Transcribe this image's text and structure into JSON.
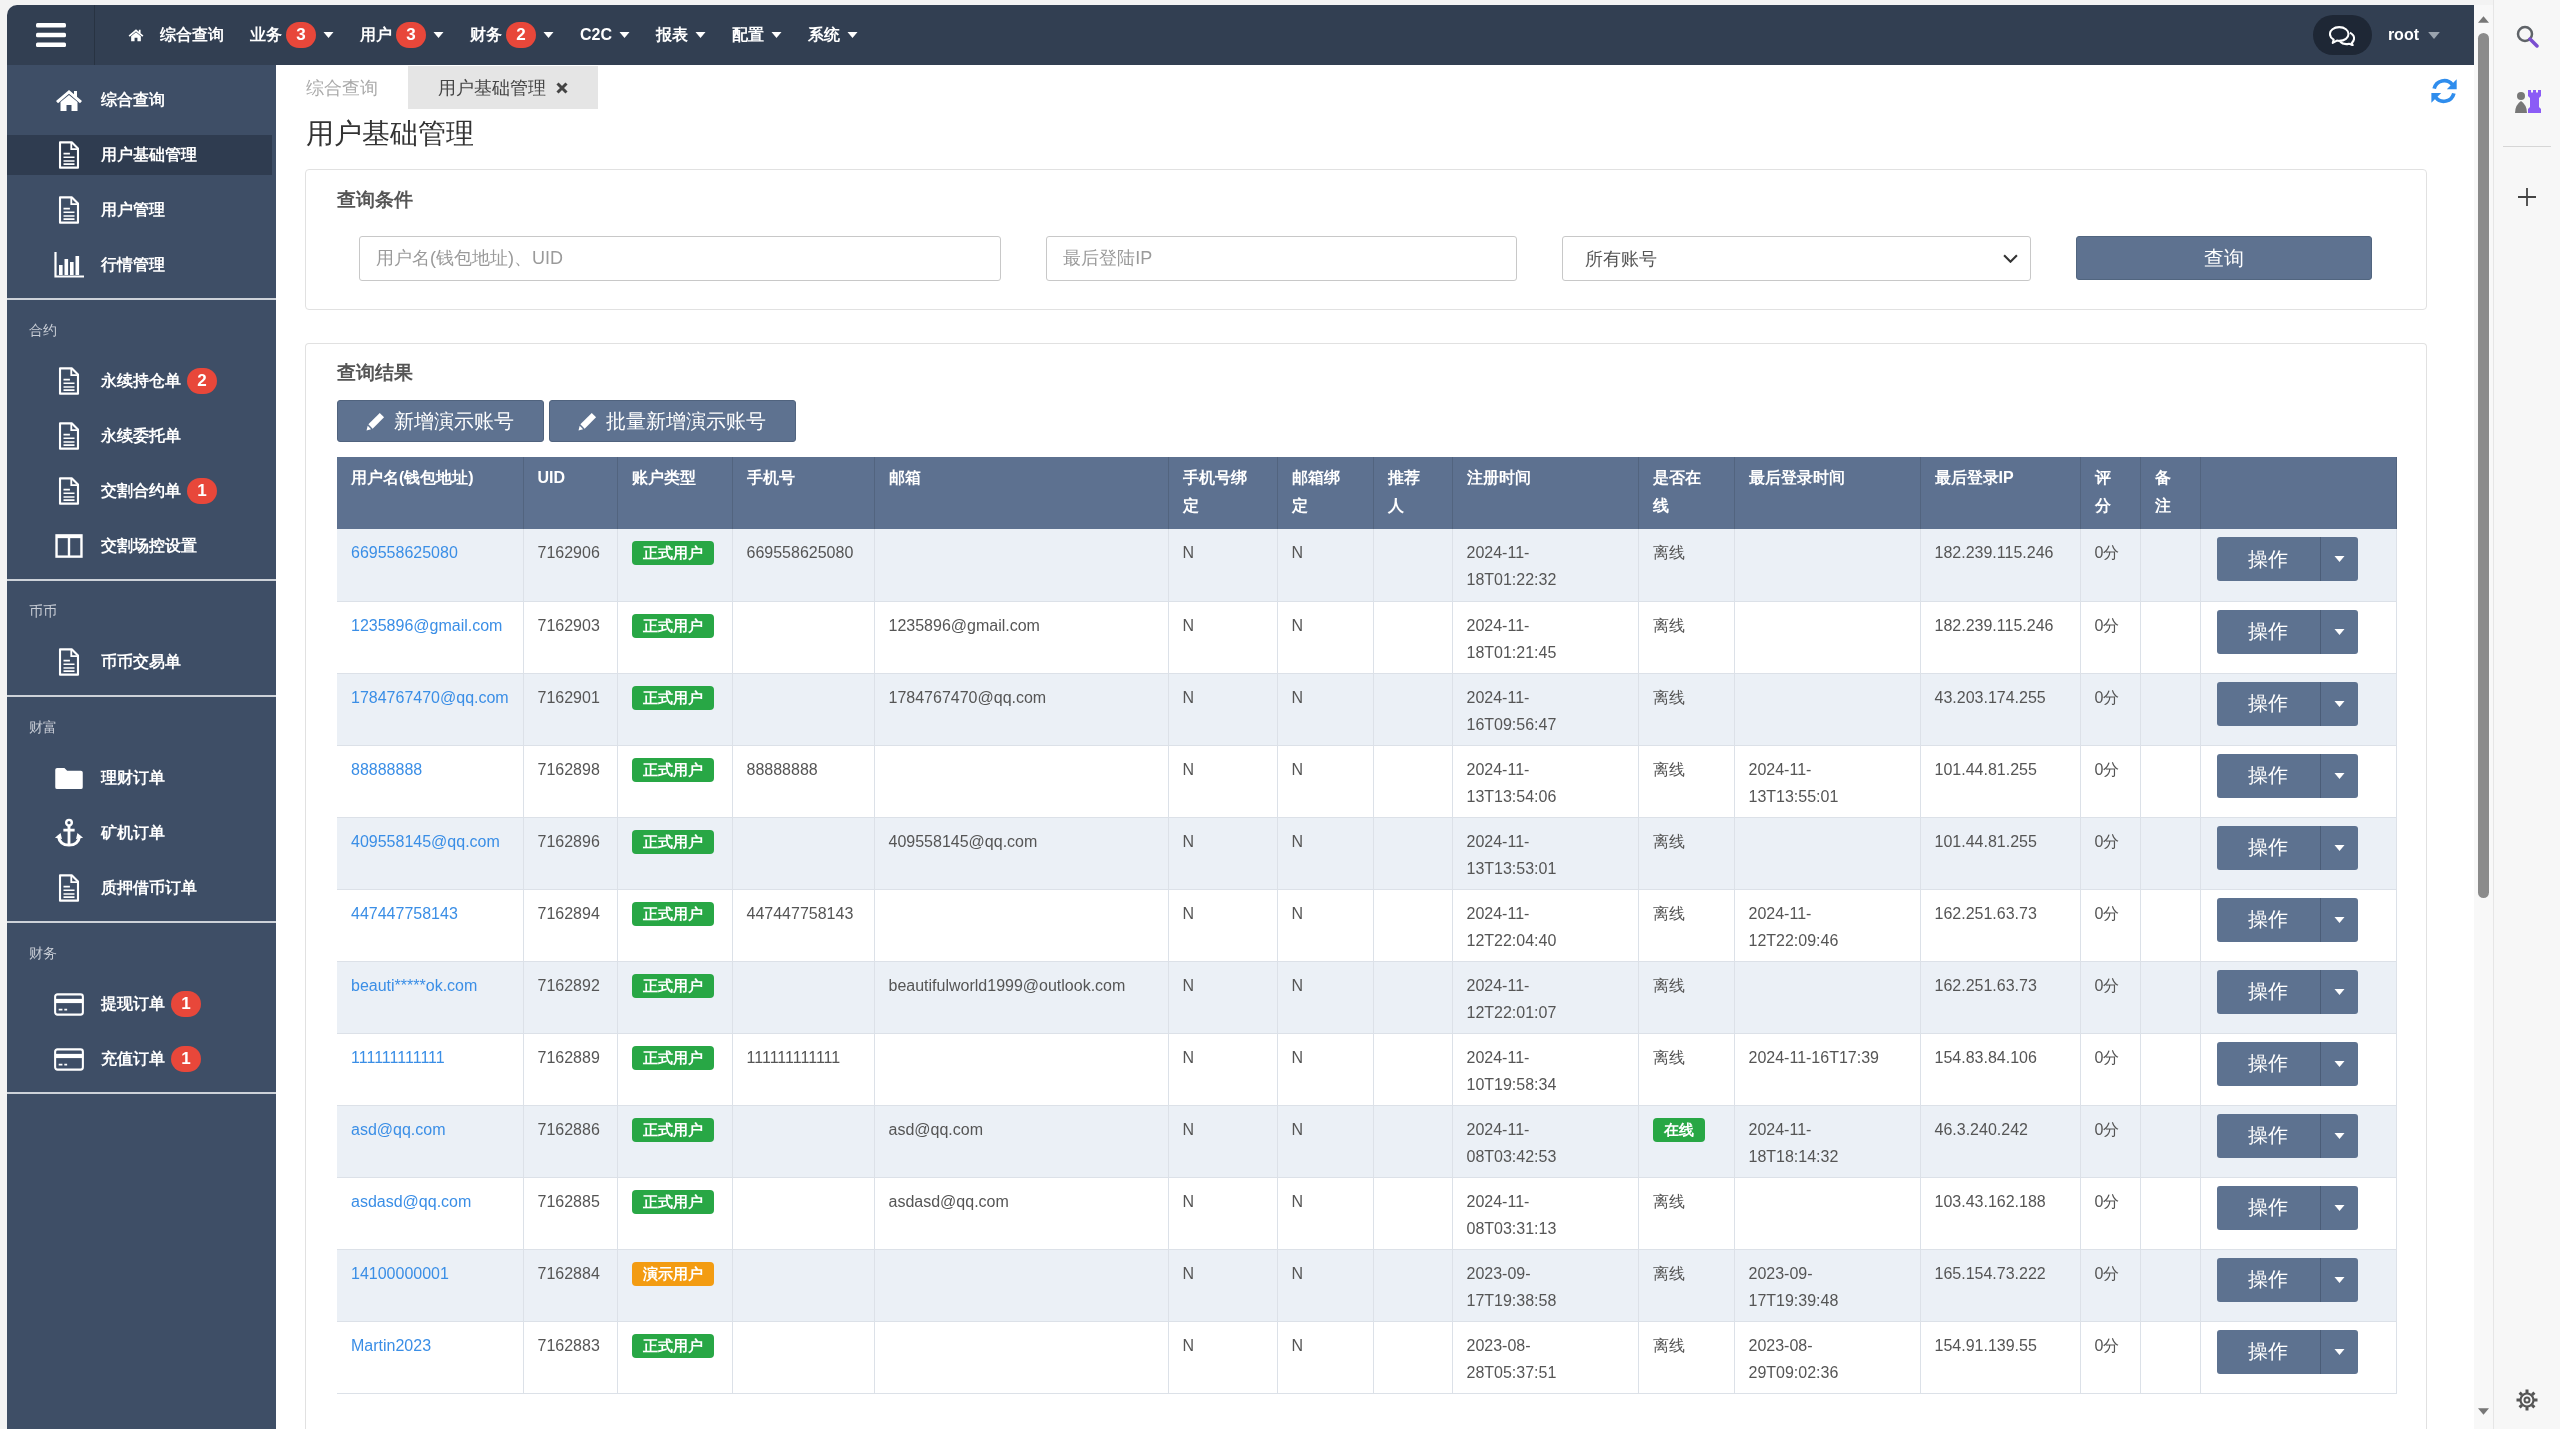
{
  "topbar": {
    "nav": [
      {
        "kind": "home",
        "label": "综合查询"
      },
      {
        "kind": "menu",
        "label": "业务",
        "badge": "3"
      },
      {
        "kind": "menu",
        "label": "用户",
        "badge": "3"
      },
      {
        "kind": "menu",
        "label": "财务",
        "badge": "2"
      },
      {
        "kind": "menu",
        "label": "C2C"
      },
      {
        "kind": "menu",
        "label": "报表"
      },
      {
        "kind": "menu",
        "label": "配置"
      },
      {
        "kind": "menu",
        "label": "系统"
      }
    ],
    "user": "root"
  },
  "sidebar": {
    "sections": [
      {
        "items": [
          {
            "kind": "home",
            "label": "综合查询",
            "selected": false
          },
          {
            "kind": "page",
            "label": "用户基础管理",
            "selected": true
          },
          {
            "kind": "page",
            "label": "用户管理",
            "selected": false
          },
          {
            "kind": "chart",
            "label": "行情管理",
            "selected": false
          }
        ]
      },
      {
        "title": "合约",
        "items": [
          {
            "kind": "page",
            "label": "永续持仓单",
            "badge": "2",
            "selected": false
          },
          {
            "kind": "page",
            "label": "永续委托单",
            "selected": false
          },
          {
            "kind": "page",
            "label": "交割合约单",
            "badge": "1",
            "selected": false
          },
          {
            "kind": "columns",
            "label": "交割场控设置",
            "selected": false
          }
        ]
      },
      {
        "title": "币币",
        "items": [
          {
            "kind": "page",
            "label": "币币交易单",
            "selected": false
          }
        ]
      },
      {
        "title": "财富",
        "items": [
          {
            "kind": "folder",
            "label": "理财订单",
            "selected": false
          },
          {
            "kind": "anchor",
            "label": "矿机订单",
            "selected": false
          },
          {
            "kind": "page",
            "label": "质押借币订单",
            "selected": false
          }
        ]
      },
      {
        "title": "财务",
        "items": [
          {
            "kind": "card",
            "label": "提现订单",
            "badge": "1",
            "selected": false
          },
          {
            "kind": "card",
            "label": "充值订单",
            "badge": "1",
            "selected": false
          }
        ]
      }
    ]
  },
  "tabs": [
    {
      "label": "综合查询",
      "selected": false,
      "closable": false
    },
    {
      "label": "用户基础管理",
      "selected": true,
      "closable": true
    }
  ],
  "page_title": "用户基础管理",
  "query": {
    "title": "查询条件",
    "fields": [
      {
        "kind": "input",
        "placeholder": "用户名(钱包地址)、UID"
      },
      {
        "kind": "input",
        "placeholder": "最后登陆IP"
      },
      {
        "kind": "select",
        "value": "所有账号"
      }
    ],
    "button": "查询"
  },
  "results": {
    "title": "查询结果",
    "buttons": [
      "新增演示账号",
      "批量新增演示账号"
    ],
    "table": {
      "columns": [
        "用户名(钱包地址)",
        "UID",
        "账户类型",
        "手机号",
        "邮箱",
        "手机号绑定",
        "邮箱绑定",
        "推荐人",
        "注册时间",
        "是否在线",
        "最后登录时间",
        "最后登录IP",
        "评分",
        "备注"
      ],
      "rows": [
        {
          "username": "669558625080",
          "uid": "7162906",
          "account_type": {
            "label": "正式用户",
            "color": "#28a745"
          },
          "phone": "669558625080",
          "phone_bound": "N",
          "email_bound": "N",
          "registered": "2024-11-18T01:22:32",
          "online": false,
          "online_label": "离线",
          "last_ip": "182.239.115.246",
          "score": "0分",
          "action": "操作"
        },
        {
          "username": "1235896@gmail.com",
          "uid": "7162903",
          "account_type": {
            "label": "正式用户",
            "color": "#28a745"
          },
          "email": "1235896@gmail.com",
          "phone_bound": "N",
          "email_bound": "N",
          "registered": "2024-11-18T01:21:45",
          "online": false,
          "online_label": "离线",
          "last_ip": "182.239.115.246",
          "score": "0分",
          "action": "操作"
        },
        {
          "username": "1784767470@qq.com",
          "uid": "7162901",
          "account_type": {
            "label": "正式用户",
            "color": "#28a745"
          },
          "email": "1784767470@qq.com",
          "phone_bound": "N",
          "email_bound": "N",
          "registered": "2024-11-16T09:56:47",
          "online": false,
          "online_label": "离线",
          "last_ip": "43.203.174.255",
          "score": "0分",
          "action": "操作"
        },
        {
          "username": "88888888",
          "uid": "7162898",
          "account_type": {
            "label": "正式用户",
            "color": "#28a745"
          },
          "phone": "88888888",
          "phone_bound": "N",
          "email_bound": "N",
          "registered": "2024-11-13T13:54:06",
          "online": false,
          "online_label": "离线",
          "last_login": "2024-11-13T13:55:01",
          "last_ip": "101.44.81.255",
          "score": "0分",
          "action": "操作"
        },
        {
          "username": "409558145@qq.com",
          "uid": "7162896",
          "account_type": {
            "label": "正式用户",
            "color": "#28a745"
          },
          "email": "409558145@qq.com",
          "phone_bound": "N",
          "email_bound": "N",
          "registered": "2024-11-13T13:53:01",
          "online": false,
          "online_label": "离线",
          "last_ip": "101.44.81.255",
          "score": "0分",
          "action": "操作"
        },
        {
          "username": "447447758143",
          "uid": "7162894",
          "account_type": {
            "label": "正式用户",
            "color": "#28a745"
          },
          "phone": "447447758143",
          "phone_bound": "N",
          "email_bound": "N",
          "registered": "2024-11-12T22:04:40",
          "online": false,
          "online_label": "离线",
          "last_login": "2024-11-12T22:09:46",
          "last_ip": "162.251.63.73",
          "score": "0分",
          "action": "操作"
        },
        {
          "username": "beauti*****ok.com",
          "uid": "7162892",
          "account_type": {
            "label": "正式用户",
            "color": "#28a745"
          },
          "email": "beautifulworld1999@outlook.com",
          "phone_bound": "N",
          "email_bound": "N",
          "registered": "2024-11-12T22:01:07",
          "online": false,
          "online_label": "离线",
          "last_ip": "162.251.63.73",
          "score": "0分",
          "action": "操作"
        },
        {
          "username": "111111111111",
          "uid": "7162889",
          "account_type": {
            "label": "正式用户",
            "color": "#28a745"
          },
          "phone": "111111111111",
          "phone_bound": "N",
          "email_bound": "N",
          "registered": "2024-11-10T19:58:34",
          "online": false,
          "online_label": "离线",
          "last_login": "2024-11-16T17:39",
          "last_ip": "154.83.84.106",
          "score": "0分",
          "action": "操作"
        },
        {
          "username": "asd@qq.com",
          "uid": "7162886",
          "account_type": {
            "label": "正式用户",
            "color": "#28a745"
          },
          "email": "asd@qq.com",
          "phone_bound": "N",
          "email_bound": "N",
          "registered": "2024-11-08T03:42:53",
          "online": true,
          "online_label": "在线",
          "last_login": "2024-11-18T18:14:32",
          "last_ip": "46.3.240.242",
          "score": "0分",
          "action": "操作"
        },
        {
          "username": "asdasd@qq.com",
          "uid": "7162885",
          "account_type": {
            "label": "正式用户",
            "color": "#28a745"
          },
          "email": "asdasd@qq.com",
          "phone_bound": "N",
          "email_bound": "N",
          "registered": "2024-11-08T03:31:13",
          "online": false,
          "online_label": "离线",
          "last_ip": "103.43.162.188",
          "score": "0分",
          "action": "操作"
        },
        {
          "username": "14100000001",
          "uid": "7162884",
          "account_type": {
            "label": "演示用户",
            "color": "#f39c12"
          },
          "phone_bound": "N",
          "email_bound": "N",
          "registered": "2023-09-17T19:38:58",
          "online": false,
          "online_label": "离线",
          "last_login": "2023-09-17T19:39:48",
          "last_ip": "165.154.73.222",
          "score": "0分",
          "action": "操作"
        },
        {
          "username": "Martin2023",
          "uid": "7162883",
          "account_type": {
            "label": "正式用户",
            "color": "#28a745"
          },
          "phone_bound": "N",
          "email_bound": "N",
          "registered": "2023-08-28T05:37:51",
          "online": false,
          "online_label": "离线",
          "last_login": "2023-08-29T09:02:36",
          "last_ip": "154.91.139.55",
          "score": "0分",
          "action": "操作"
        }
      ]
    }
  }
}
